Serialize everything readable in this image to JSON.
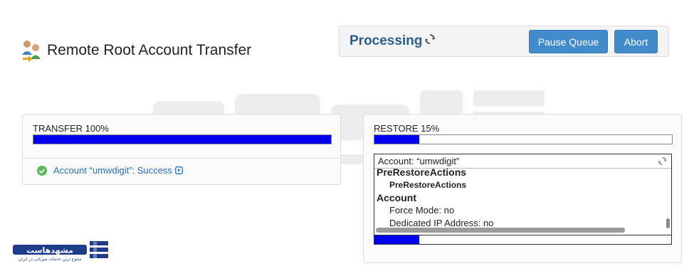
{
  "page": {
    "title": "Remote Root Account Transfer"
  },
  "queue": {
    "status_label": "Processing",
    "pause_label": "Pause Queue",
    "abort_label": "Abort"
  },
  "transfer": {
    "heading": "TRANSFER 100%",
    "progress_percent": 100,
    "status_text": "Account “umwdigit”: Success"
  },
  "restore": {
    "heading": "RESTORE 15%",
    "progress_percent": 15,
    "log": {
      "header": "Account: “umwdigit”",
      "lines": {
        "l0": "PreRestoreActions",
        "l1": "PreRestoreActions",
        "l2": "Account",
        "l3": "Force Mode: no",
        "l4": "Dedicated IP Address: no"
      },
      "inner_progress_percent": 15
    }
  },
  "colors": {
    "accent": "#428bca",
    "progress": "#0000ee",
    "processing": "#2a5f8a",
    "success": "#5cb85c",
    "link": "#2a6fb5"
  },
  "logo": {
    "text": "مشهدهاست",
    "tagline": "متنوع ترین خدمات میزبانی در ایران"
  }
}
